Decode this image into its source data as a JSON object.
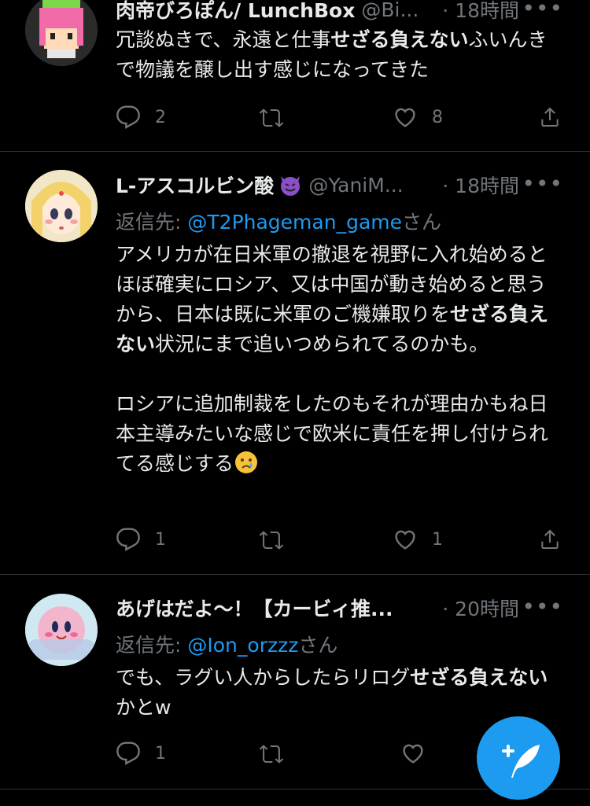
{
  "tweets": [
    {
      "name": "肉帝びろぽん/ LunchBox",
      "handle": "@Bi...",
      "time": "· 18時間",
      "body_parts": [
        "冗談ぬきで、永遠と仕事",
        "せざる負えない",
        "ふいんきで物議を醸し出す感じになってきた"
      ],
      "reply_count": "2",
      "like_count": "8"
    },
    {
      "name": "L-アスコルビン酸",
      "name_emoji": "smiling-imp-emoji",
      "handle": "@YaniM...",
      "time": "· 18時間",
      "reply_label": "返信先:",
      "reply_target": "@T2Phageman_game",
      "reply_suffix": "さん",
      "body_p1_parts": [
        "アメリカが在日米軍の撤退を視野に入れ始めるとほぼ確実にロシア、又は中国が動き始めると思うから、日本は既に米軍のご機嫌取りを",
        "せざる負えない",
        "状況にまで追いつめられてるのかも。"
      ],
      "body_p2": "ロシアに追加制裁をしたのもそれが理由かもね日本主導みたいな感じで欧米に責任を押し付けられてる感じする",
      "body_emoji": "crying-face-emoji",
      "reply_count": "1",
      "like_count": "1"
    },
    {
      "name": "あげはだよ〜！【カービィ推...",
      "handle": "",
      "time": "· 20時間",
      "reply_label": "返信先:",
      "reply_target": "@Ion_orzzz",
      "reply_suffix": "さん",
      "body_parts": [
        "でも、ラグい人からしたらリログ",
        "せざる負えない",
        "かとw"
      ],
      "reply_count": "1",
      "like_count": ""
    }
  ],
  "more_label": "•••",
  "icons": {
    "reply": "reply-icon",
    "retweet": "retweet-icon",
    "like": "like-icon",
    "share": "share-icon",
    "compose": "compose-tweet-icon"
  },
  "colors": {
    "background": "#000000",
    "text": "#e7e9ea",
    "muted": "#71767b",
    "accent": "#1d9bf0",
    "divider": "#2f3336"
  }
}
